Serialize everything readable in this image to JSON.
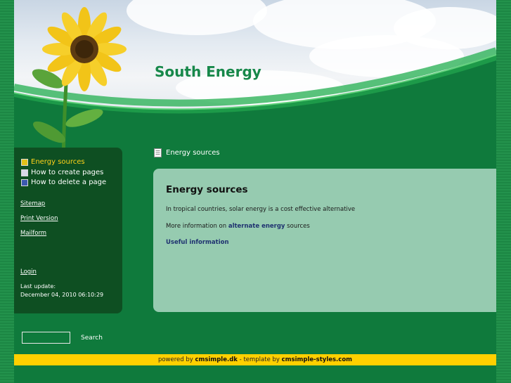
{
  "site": {
    "title": "South Energy"
  },
  "menu": [
    {
      "label": "Energy sources",
      "active": true
    },
    {
      "label": "How to create pages",
      "active": false
    },
    {
      "label": "How to delete a page",
      "active": false
    }
  ],
  "sidebar": {
    "sitemap": "Sitemap",
    "print_version": "Print Version",
    "mailform": "Mailform",
    "login": "Login",
    "last_update_label": "Last update:",
    "last_update_value": "December 04, 2010 06:10:29"
  },
  "breadcrumb": {
    "label": "Energy sources"
  },
  "content": {
    "heading": "Energy sources",
    "para1": "In tropical countries,  solar energy is a cost effective alternative",
    "para2_before": "More information on ",
    "para2_link": "alternate energy",
    "para2_after": " sources",
    "useful_link": "Useful information"
  },
  "search": {
    "value": "",
    "button_label": "Search"
  },
  "footer": {
    "powered_by": "powered by ",
    "cms_link": "cmsimple.dk",
    "template_by": " - template by ",
    "template_link": "cmsimple-styles.com"
  },
  "colors": {
    "page_green": "#0f7a3c",
    "title_green": "#17884a",
    "footer_yellow": "#ffd000",
    "content_bg": "#96cbb0",
    "active_menu": "#ffd21a"
  },
  "icons": [
    "sunflower-image",
    "menu-page-icon",
    "document-icon"
  ]
}
